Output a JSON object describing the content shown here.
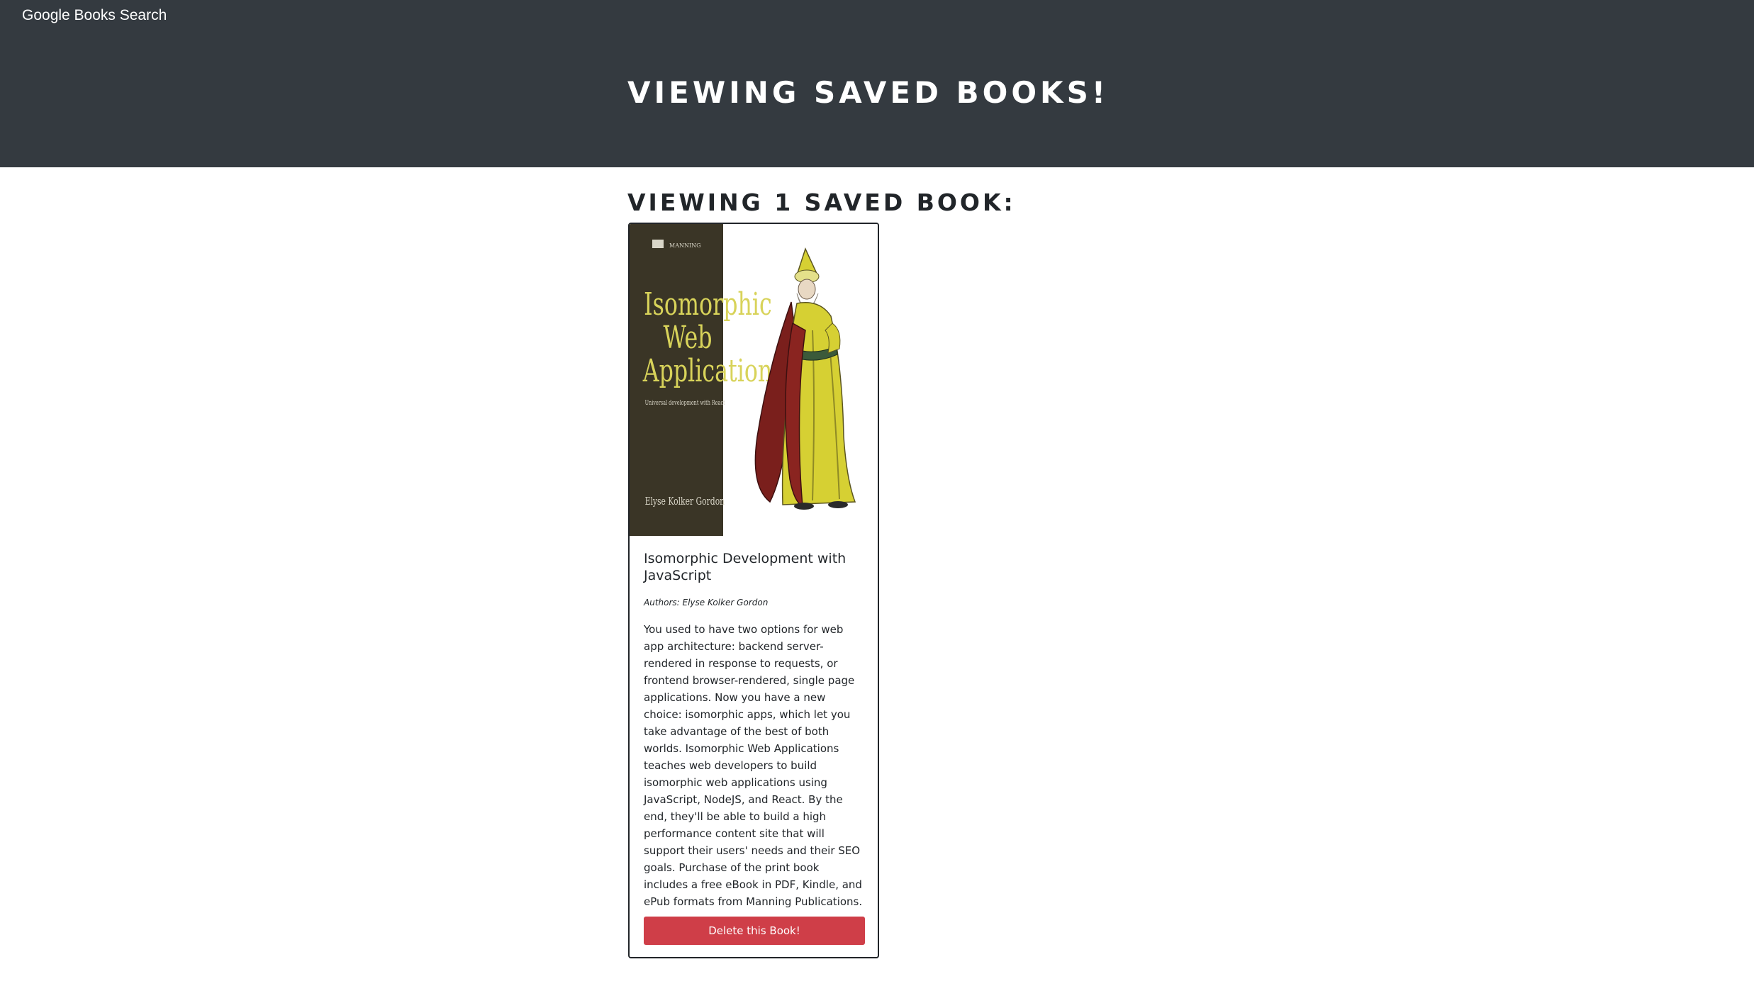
{
  "navbar": {
    "brand": "Google Books Search"
  },
  "hero": {
    "title": "Viewing saved books!"
  },
  "saved": {
    "count_heading": "Viewing 1 saved book:",
    "books": [
      {
        "cover": {
          "publisher_mark": "MANNING",
          "title_lines": [
            "Isomorphic",
            "Web",
            "Applications"
          ],
          "subtitle": "Universal development with React",
          "author": "Elyse Kolker Gordon",
          "colors": {
            "spine": "#3a3526",
            "title_text": "#d8d35a",
            "robe": "#d6d033",
            "cloak": "#7a1f1c"
          }
        },
        "title": "Isomorphic Development with JavaScript",
        "authors": "Authors: Elyse Kolker Gordon",
        "description": "You used to have two options for web app architecture: backend server-rendered in response to requests, or frontend browser-rendered, single page applications. Now you have a new choice: isomorphic apps, which let you take advantage of the best of both worlds. Isomorphic Web Applications teaches web developers to build isomorphic web applications using JavaScript, NodeJS, and React. By the end, they'll be able to build a high performance content site that will support their users' needs and their SEO goals. Purchase of the print book includes a free eBook in PDF, Kindle, and ePub formats from Manning Publications.",
        "delete_label": "Delete this Book!"
      }
    ]
  },
  "colors": {
    "header_bg": "#343a40",
    "danger": "#cf3e48",
    "text": "#212529"
  }
}
